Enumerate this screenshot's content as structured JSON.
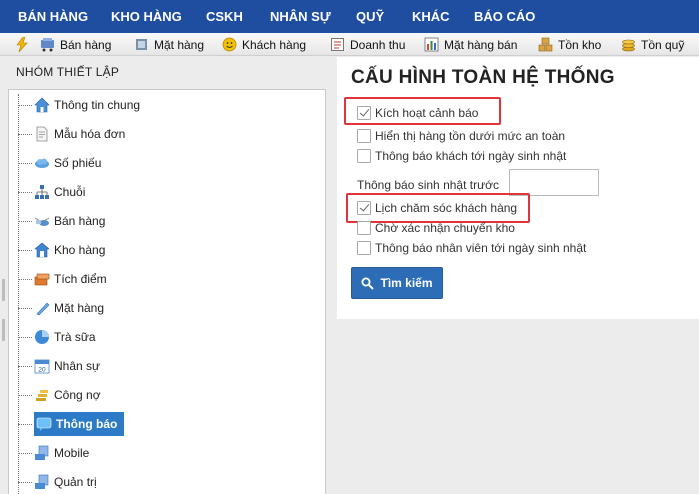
{
  "menu": {
    "items": [
      {
        "label": "BÁN HÀNG"
      },
      {
        "label": "KHO HÀNG"
      },
      {
        "label": "CSKH"
      },
      {
        "label": "NHÂN SỰ"
      },
      {
        "label": "QUỸ"
      },
      {
        "label": "KHÁC"
      },
      {
        "label": "BÁO CÁO"
      }
    ]
  },
  "toolbar": {
    "items": [
      {
        "label": "Bán hàng",
        "icon": "cart-icon"
      },
      {
        "label": "Mặt hàng",
        "icon": "product-icon"
      },
      {
        "label": "Khách hàng",
        "icon": "customer-icon"
      },
      {
        "label": "Doanh thu",
        "icon": "revenue-icon"
      },
      {
        "label": "Mặt hàng bán",
        "icon": "chart-icon"
      },
      {
        "label": "Tồn kho",
        "icon": "stock-icon"
      },
      {
        "label": "Tồn quỹ",
        "icon": "coins-icon"
      }
    ]
  },
  "sidebar": {
    "title": "NHÓM THIẾT LẬP",
    "items": [
      {
        "label": "Thông tin chung",
        "icon": "home-icon",
        "color": "#4a90d9"
      },
      {
        "label": "Mẫu hóa đơn",
        "icon": "document-icon",
        "color": "#9a9a9a"
      },
      {
        "label": "Số phiếu",
        "icon": "cloud-icon",
        "color": "#5aa0e0"
      },
      {
        "label": "Chuỗi",
        "icon": "sitemap-icon",
        "color": "#3a6fb0"
      },
      {
        "label": "Bán hàng",
        "icon": "pos-icon",
        "color": "#5a8fc8"
      },
      {
        "label": "Kho hàng",
        "icon": "warehouse-icon",
        "color": "#3d85d0"
      },
      {
        "label": "Tích điểm",
        "icon": "reward-icon",
        "color": "#e07a30"
      },
      {
        "label": "Mặt hàng",
        "icon": "tag-icon",
        "color": "#6aa8e8"
      },
      {
        "label": "Trà sữa",
        "icon": "pie-icon",
        "color": "#3a8ad8"
      },
      {
        "label": "Nhân sự",
        "icon": "calendar-icon",
        "color": "#4a8ad0"
      },
      {
        "label": "Công nợ",
        "icon": "money-icon",
        "color": "#d4a020"
      },
      {
        "label": "Thông báo",
        "icon": "message-icon",
        "color": "#ffffff"
      },
      {
        "label": "Mobile",
        "icon": "mobile-icon",
        "color": "#4a8ad0"
      },
      {
        "label": "Quản trị",
        "icon": "admin-icon",
        "color": "#4a8ad0"
      }
    ],
    "active_index": 11
  },
  "main": {
    "title": "CẤU HÌNH TOÀN HỆ THỐNG",
    "options_group1": [
      {
        "label": "Kích hoạt cảnh báo",
        "checked": true
      },
      {
        "label": "Hiển thị hàng tồn dưới mức an toàn",
        "checked": false
      },
      {
        "label": "Thông báo khách tới ngày sinh nhật",
        "checked": false
      }
    ],
    "birthday_field": {
      "label": "Thông báo sinh nhật trước",
      "value": ""
    },
    "options_group2": [
      {
        "label": "Lịch chăm sóc khách hàng",
        "checked": true
      },
      {
        "label": "Chờ xác nhận chuyển kho",
        "checked": false
      },
      {
        "label": "Thông báo nhân viên tới ngày sinh nhật",
        "checked": false
      }
    ],
    "search_button": "Tìm kiếm"
  },
  "colors": {
    "menu_bg": "#1f4ea1",
    "active_item": "#2d7bc6",
    "button": "#2d6db7",
    "highlight": "#e0343a"
  }
}
